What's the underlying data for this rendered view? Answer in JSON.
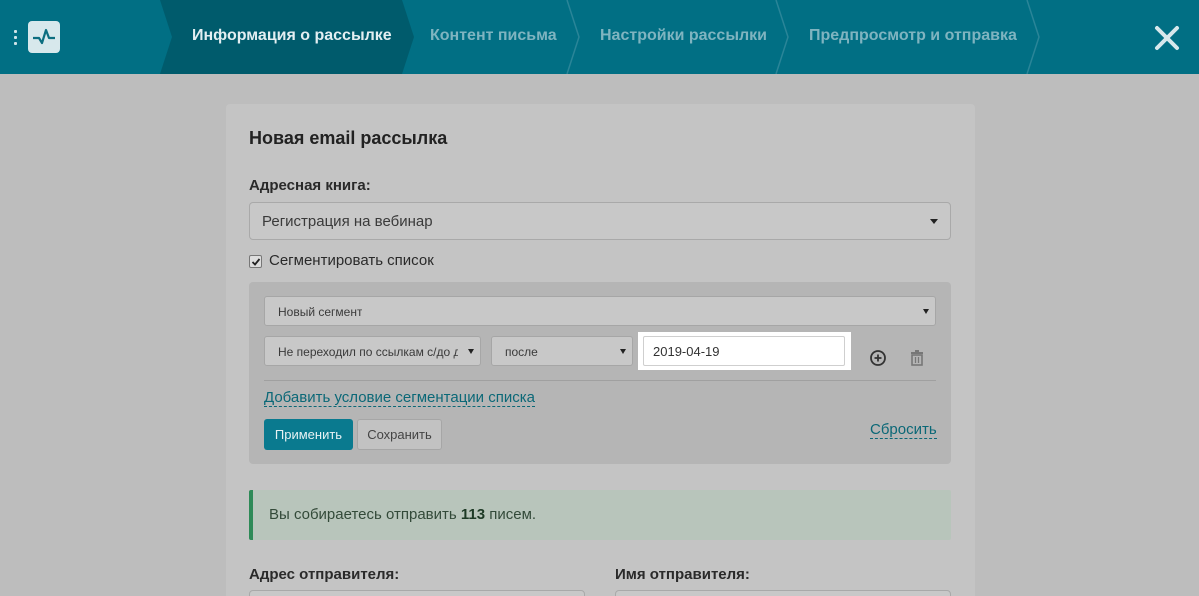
{
  "header": {
    "steps": [
      {
        "label": "Информация о рассылке",
        "active": true
      },
      {
        "label": "Контент письма",
        "active": false
      },
      {
        "label": "Настройки рассылки",
        "active": false
      },
      {
        "label": "Предпросмотр и отправка",
        "active": false
      }
    ],
    "icons": {
      "menu": "vertical-dots-icon",
      "logo": "pulse-logo-icon",
      "close": "close-icon"
    }
  },
  "form": {
    "title": "Новая email рассылка",
    "address_book": {
      "label": "Адресная книга:",
      "value": "Регистрация на вебинар"
    },
    "segment_checkbox": {
      "label": "Сегментировать список",
      "checked": true
    },
    "segment": {
      "segment_select": "Новый сегмент",
      "condition_select": "Не переходил по ссылкам с/до д",
      "operator_select": "после",
      "date_value": "2019-04-19",
      "add_condition_link": "Добавить условие сегментации списка",
      "apply_button": "Применить",
      "save_button": "Сохранить",
      "reset_link": "Сбросить"
    },
    "notice": {
      "prefix": "Вы собираетесь отправить",
      "count": "113",
      "suffix": "писем."
    },
    "sender_address_label": "Адрес отправителя:",
    "sender_name_label": "Имя отправителя:"
  },
  "colors": {
    "header_bg": "#016f84",
    "primary": "#0a7a8f",
    "success_border": "#2e8a57"
  }
}
